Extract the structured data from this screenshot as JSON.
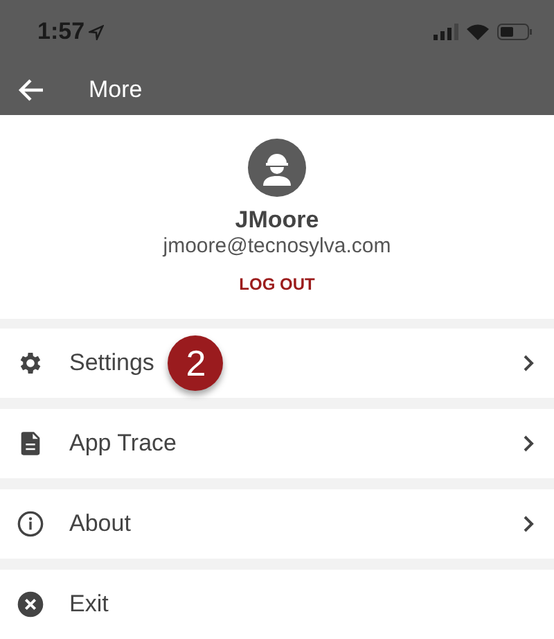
{
  "status_bar": {
    "time": "1:57"
  },
  "app_bar": {
    "title": "More"
  },
  "profile": {
    "username": "JMoore",
    "email": "jmoore@tecnosylva.com",
    "logout": "LOG OUT"
  },
  "menu": [
    {
      "label": "Settings",
      "kind": "link",
      "callout": "2"
    },
    {
      "label": "App Trace",
      "kind": "link"
    },
    {
      "label": "About",
      "kind": "link"
    },
    {
      "label": "Exit",
      "kind": "action"
    }
  ]
}
